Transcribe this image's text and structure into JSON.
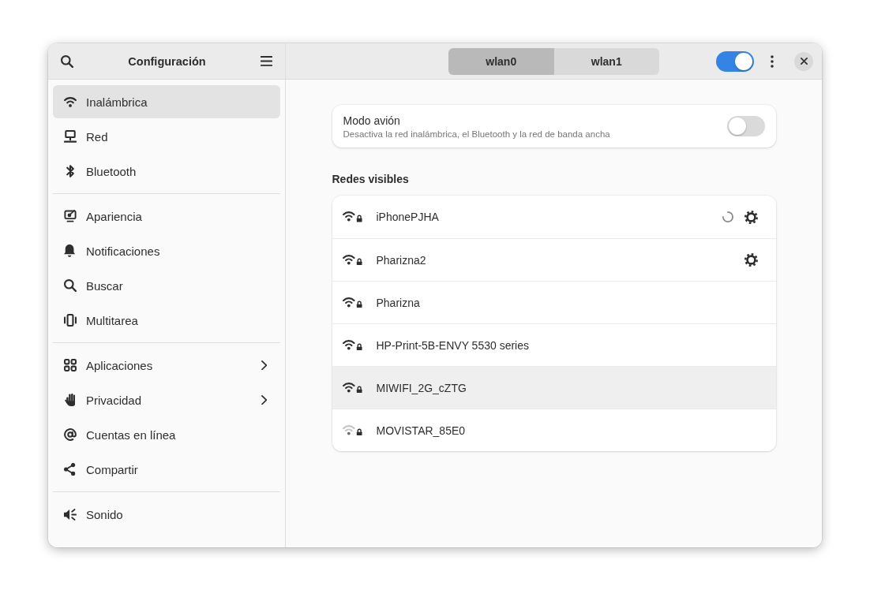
{
  "sidebar": {
    "title": "Configuración",
    "groups": [
      {
        "items": [
          {
            "kind": "wifi",
            "label": "Inalámbrica",
            "selected": true,
            "has_submenu": false
          },
          {
            "kind": "network",
            "label": "Red",
            "selected": false,
            "has_submenu": false
          },
          {
            "kind": "bluetooth",
            "label": "Bluetooth",
            "selected": false,
            "has_submenu": false
          }
        ]
      },
      {
        "items": [
          {
            "kind": "appearance",
            "label": "Apariencia",
            "selected": false,
            "has_submenu": false
          },
          {
            "kind": "notifications",
            "label": "Notificaciones",
            "selected": false,
            "has_submenu": false
          },
          {
            "kind": "search",
            "label": "Buscar",
            "selected": false,
            "has_submenu": false
          },
          {
            "kind": "multitasking",
            "label": "Multitarea",
            "selected": false,
            "has_submenu": false
          }
        ]
      },
      {
        "items": [
          {
            "kind": "apps",
            "label": "Aplicaciones",
            "selected": false,
            "has_submenu": true
          },
          {
            "kind": "privacy",
            "label": "Privacidad",
            "selected": false,
            "has_submenu": true
          },
          {
            "kind": "accounts",
            "label": "Cuentas en línea",
            "selected": false,
            "has_submenu": false
          },
          {
            "kind": "sharing",
            "label": "Compartir",
            "selected": false,
            "has_submenu": false
          }
        ]
      },
      {
        "items": [
          {
            "kind": "sound",
            "label": "Sonido",
            "selected": false,
            "has_submenu": false
          }
        ]
      }
    ]
  },
  "header": {
    "tabs": [
      {
        "label": "wlan0",
        "selected": true
      },
      {
        "label": "wlan1",
        "selected": false
      }
    ],
    "wifi_switch": {
      "on": true
    }
  },
  "airplane_mode": {
    "title": "Modo avión",
    "subtitle": "Desactiva la red inalámbrica, el Bluetooth y la red de banda ancha",
    "on": false
  },
  "networks": {
    "title": "Redes visibles",
    "rows": [
      {
        "name": "iPhonePJHA",
        "weak_signal": false,
        "secured": true,
        "connecting": true,
        "settings_button": true,
        "hovered": false
      },
      {
        "name": "Pharizna2",
        "weak_signal": false,
        "secured": true,
        "connecting": false,
        "settings_button": true,
        "hovered": false
      },
      {
        "name": "Pharizna",
        "weak_signal": false,
        "secured": true,
        "connecting": false,
        "settings_button": false,
        "hovered": false
      },
      {
        "name": "HP-Print-5B-ENVY 5530 series",
        "weak_signal": false,
        "secured": true,
        "connecting": false,
        "settings_button": false,
        "hovered": false
      },
      {
        "name": "MIWIFI_2G_cZTG",
        "weak_signal": false,
        "secured": true,
        "connecting": false,
        "settings_button": false,
        "hovered": true
      },
      {
        "name": "MOVISTAR_85E0",
        "weak_signal": true,
        "secured": true,
        "connecting": false,
        "settings_button": false,
        "hovered": false
      }
    ]
  }
}
